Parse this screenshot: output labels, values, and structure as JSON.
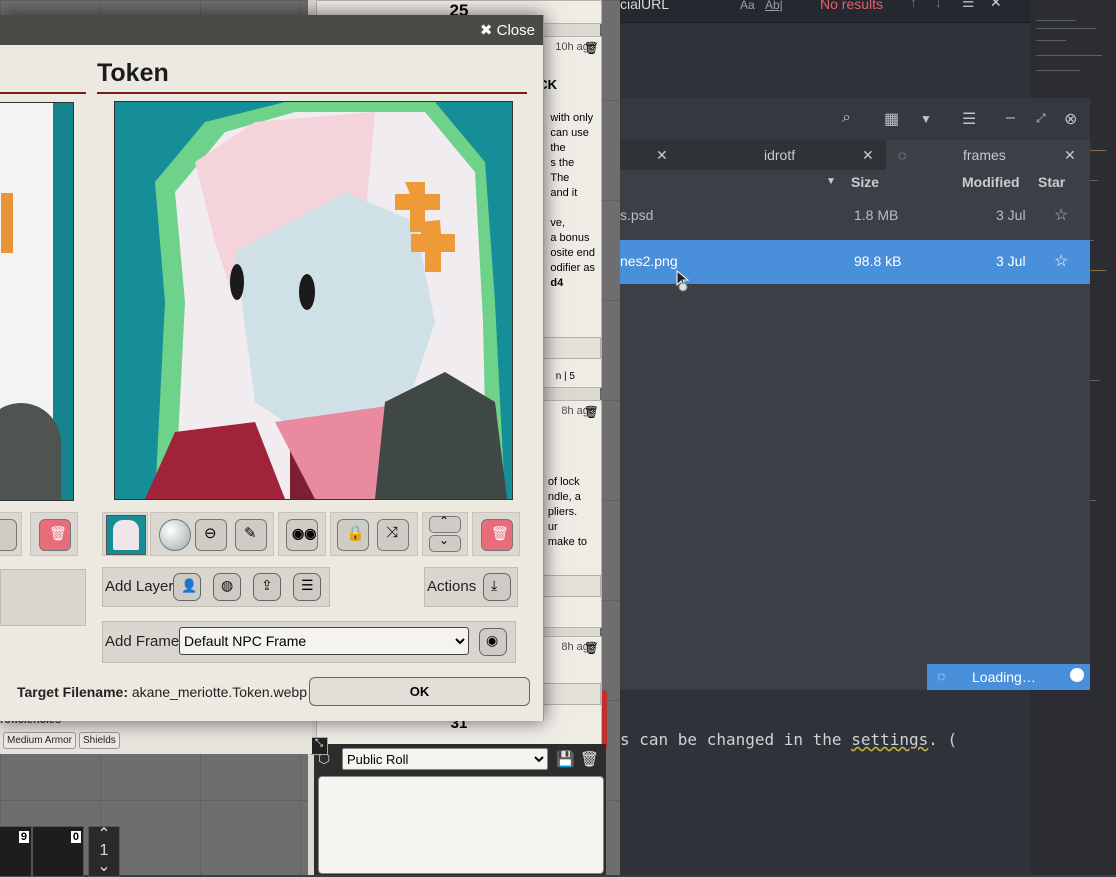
{
  "vtt": {
    "sheet_tags": [
      "Medium Armor",
      "Shields"
    ],
    "sheet_heading": "roficiencies",
    "hotbar": {
      "slot1": "9",
      "slot2": "0",
      "page": "1"
    }
  },
  "editor": {
    "search_text": "cialURL",
    "search_opt_case": "Aa",
    "search_opt_word": "Ab|",
    "search_result": "No results",
    "code_before": "s can be changed in the ",
    "code_underlined": "settings",
    "code_after": ". (",
    "faded_text": "only"
  },
  "file_manager": {
    "tabs": [
      {
        "label": "idrotf"
      },
      {
        "label": "frames"
      }
    ],
    "columns": {
      "size": "Size",
      "modified": "Modified",
      "star": "Star"
    },
    "rows": [
      {
        "name": "s.psd",
        "size": "1.8 MB",
        "modified": "3 Jul",
        "selected": false
      },
      {
        "name": "nes2.png",
        "size": "98.8 kB",
        "modified": "3 Jul",
        "selected": true
      }
    ],
    "loading": "Loading…"
  },
  "sidebar": {
    "roll_value_top": "25",
    "roll_value_bottom": "31",
    "cards": [
      {
        "time": "10h ago",
        "heading": "CK",
        "lines": [
          "with only",
          "can use",
          "the",
          "s the",
          "The",
          "and it",
          "",
          "ve,",
          "a bonus",
          "osite end",
          "odifier as",
          "d4"
        ],
        "footer": "n  |  5"
      },
      {
        "time": "8h ago",
        "lines": [
          "of lock",
          "ndle, a",
          "pliers.",
          "ur",
          "make to"
        ]
      },
      {
        "time": "8h ago"
      }
    ],
    "roll_mode": "Public Roll"
  },
  "dialog": {
    "close_label": "Close",
    "section_title": "Token",
    "add_layer_label": "Add Layer",
    "actions_label": "Actions",
    "add_frame_label": "Add Frame",
    "frame_options": [
      "Default NPC Frame"
    ],
    "frame_selected": "Default NPC Frame",
    "target_label": "Target Filename:",
    "target_value": "akane_meriotte.Token.webp",
    "ok_label": "OK"
  }
}
